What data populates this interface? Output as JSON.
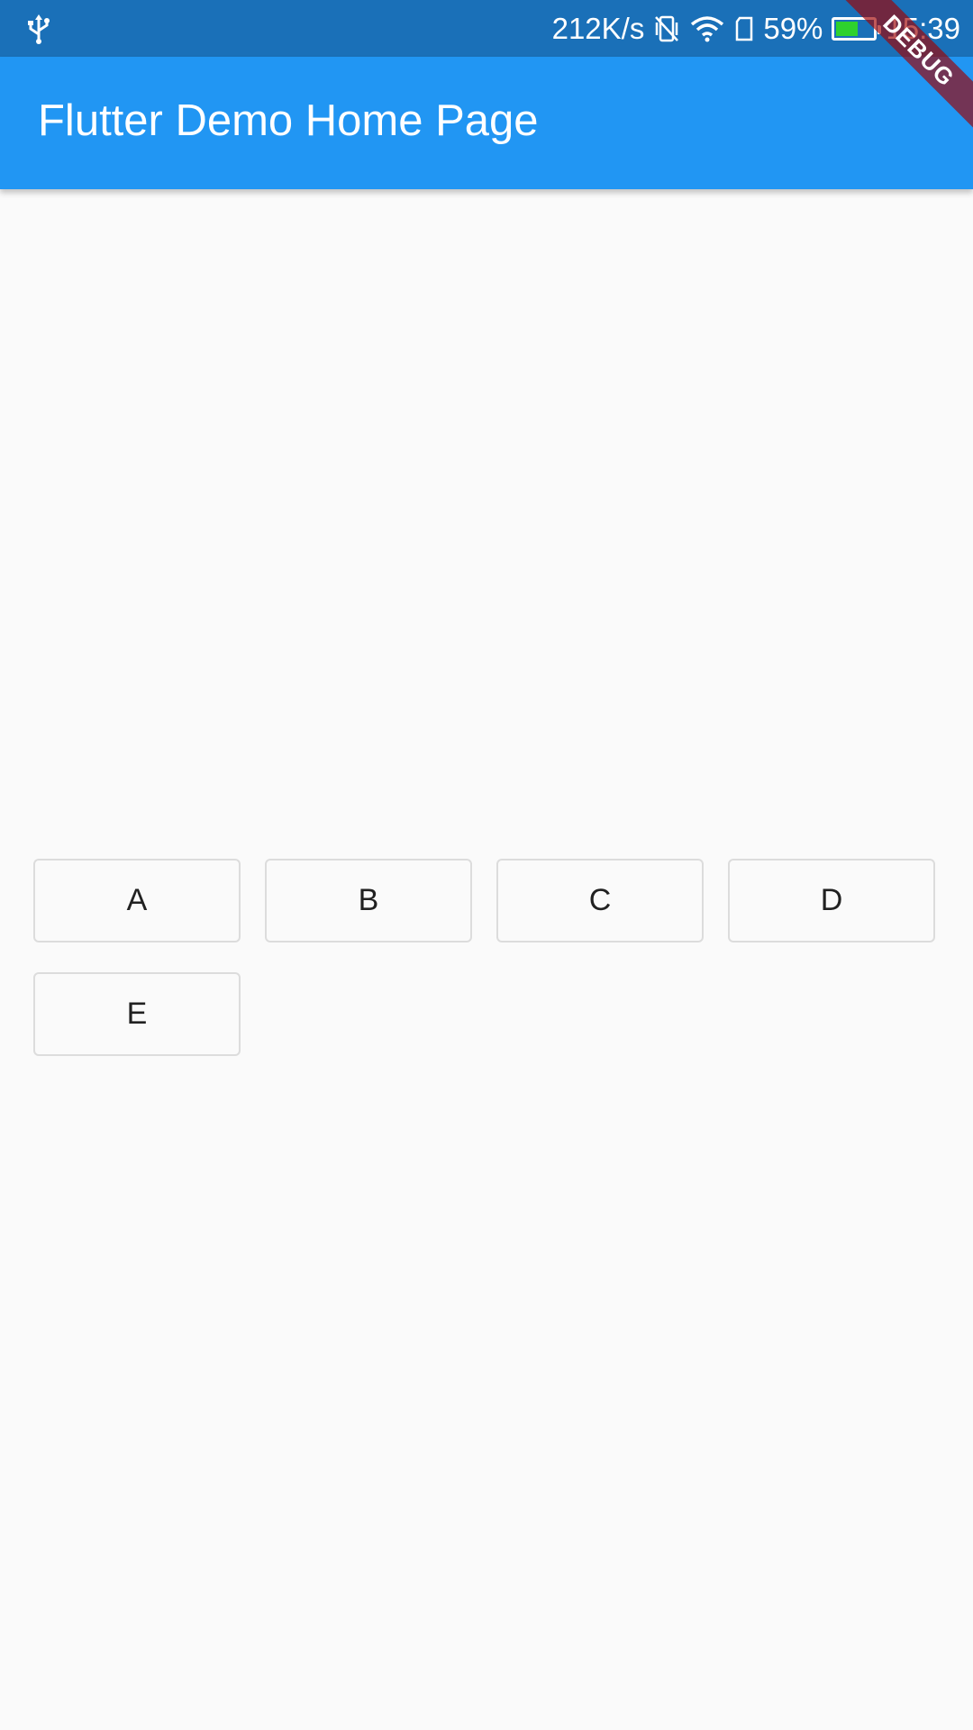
{
  "status_bar": {
    "net_speed": "212K/s",
    "battery_percent": "59%",
    "battery_level": 0.59,
    "time": "15:39",
    "icons": [
      "usb-icon",
      "vibrate-icon",
      "wifi-icon",
      "sim-icon",
      "battery-icon"
    ],
    "bg_color": "#1a70b8"
  },
  "app_bar": {
    "title": "Flutter Demo Home Page",
    "bg_color": "#2196f3"
  },
  "debug_banner": {
    "label": "DEBUG"
  },
  "buttons": [
    {
      "label": "A"
    },
    {
      "label": "B"
    },
    {
      "label": "C"
    },
    {
      "label": "D"
    },
    {
      "label": "E"
    }
  ]
}
